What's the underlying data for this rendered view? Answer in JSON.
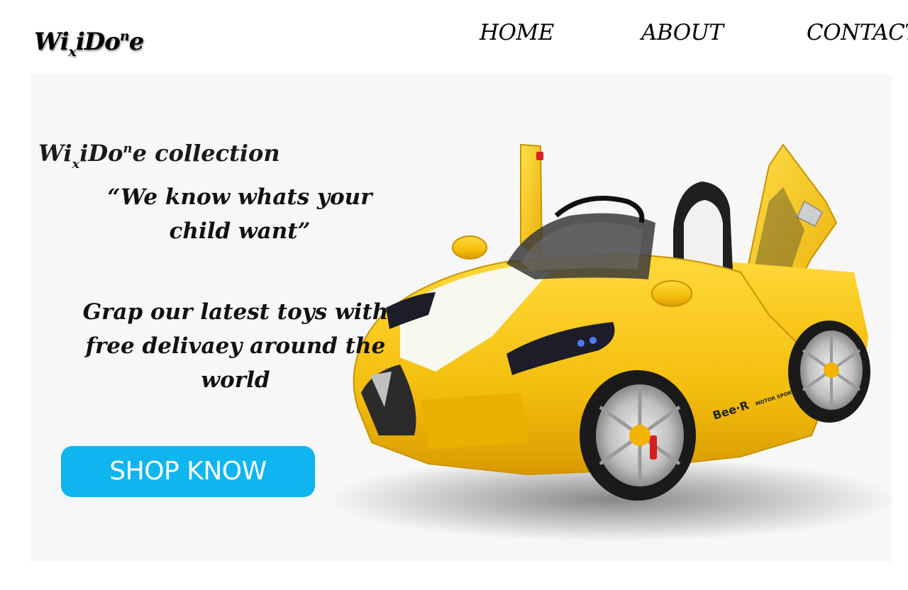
{
  "brand": {
    "logo": {
      "part1": "Wi",
      "sub": "x",
      "part2": "iDo",
      "sup": "n",
      "part3": "e"
    }
  },
  "nav": {
    "home": "HOME",
    "about": "ABOUT",
    "contact": "CONTACT"
  },
  "hero": {
    "title": {
      "part1": "Wi",
      "sub": "x",
      "part2": "iDo",
      "sup": "n",
      "part3": "e collection"
    },
    "tagline": "“We know whats your child want”",
    "promo": "Grap our latest toys with free delivaey around the world",
    "cta_label": "SHOP KNOW",
    "image": "yellow-ride-on-toy-car",
    "image_badge": "Bee·R",
    "image_badge_2": "MOTOR SPORTS"
  },
  "colors": {
    "cta": "#0fb5ee",
    "hero_bg": "#f7f7f7",
    "car_body": "#f7c613"
  }
}
